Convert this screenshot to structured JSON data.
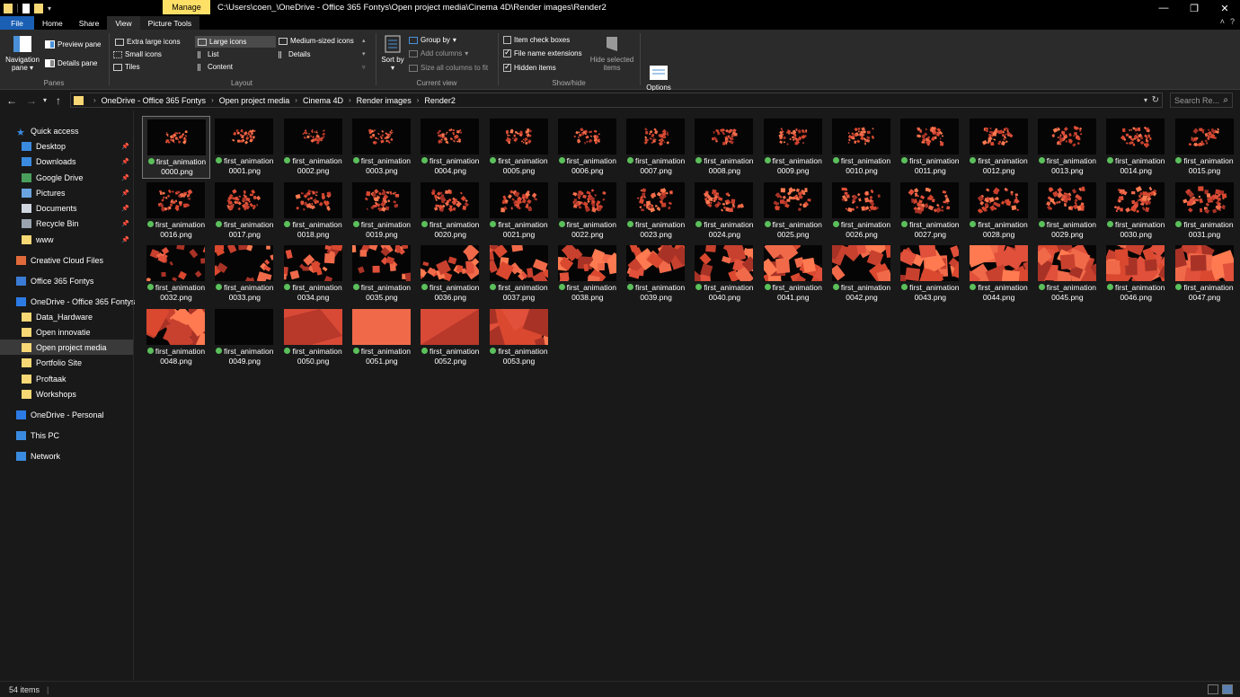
{
  "window": {
    "title_path": "C:\\Users\\coen_\\OneDrive - Office 365 Fontys\\Open project media\\Cinema 4D\\Render images\\Render2",
    "contextual_tab_header": "Manage",
    "controls": {
      "minimize": "—",
      "maximize": "❐",
      "close": "✕"
    }
  },
  "tabs": {
    "file": "File",
    "home": "Home",
    "share": "Share",
    "view": "View",
    "picture_tools": "Picture Tools",
    "collapse_glyph": "˄",
    "help_glyph": "?"
  },
  "ribbon": {
    "panes": {
      "label": "Panes",
      "navigation_pane": "Navigation pane",
      "preview_pane": "Preview pane",
      "details_pane": "Details pane"
    },
    "layout": {
      "label": "Layout",
      "extra_large_icons": "Extra large icons",
      "large_icons": "Large icons",
      "medium_icons": "Medium-sized icons",
      "small_icons": "Small icons",
      "list": "List",
      "details": "Details",
      "tiles": "Tiles",
      "content": "Content"
    },
    "current_view": {
      "label": "Current view",
      "sort_by": "Sort by",
      "group_by": "Group by",
      "add_columns": "Add columns",
      "size_all_columns": "Size all columns to fit"
    },
    "show_hide": {
      "label": "Show/hide",
      "item_check_boxes": "Item check boxes",
      "item_check_boxes_checked": false,
      "file_name_extensions": "File name extensions",
      "file_name_extensions_checked": true,
      "hidden_items": "Hidden items",
      "hidden_items_checked": true,
      "hide_selected_items": "Hide selected items"
    },
    "options": "Options"
  },
  "address": {
    "breadcrumbs": [
      "OneDrive - Office 365 Fontys",
      "Open project media",
      "Cinema 4D",
      "Render images",
      "Render2"
    ],
    "search_placeholder": "Search Re..."
  },
  "sidebar": {
    "items": [
      {
        "label": "Quick access",
        "icon": "star-icon",
        "pinned": false
      },
      {
        "label": "Desktop",
        "icon": "desktop-icon",
        "pinned": true
      },
      {
        "label": "Downloads",
        "icon": "download-icon",
        "pinned": true
      },
      {
        "label": "Google Drive",
        "icon": "drive-icon",
        "pinned": true
      },
      {
        "label": "Pictures",
        "icon": "pictures-icon",
        "pinned": true
      },
      {
        "label": "Documents",
        "icon": "documents-icon",
        "pinned": true
      },
      {
        "label": "Recycle Bin",
        "icon": "recycle-bin-icon",
        "pinned": true
      },
      {
        "label": "www",
        "icon": "folder-icon",
        "pinned": true
      },
      {
        "label": "Creative Cloud Files",
        "icon": "creative-cloud-icon",
        "pinned": false
      },
      {
        "label": "Office 365 Fontys",
        "icon": "office-icon",
        "pinned": false
      },
      {
        "label": "OneDrive - Office 365 Fontys",
        "icon": "onedrive-icon",
        "pinned": false
      },
      {
        "label": "Data_Hardware",
        "icon": "folder-icon",
        "pinned": false
      },
      {
        "label": "Open innovatie",
        "icon": "folder-icon",
        "pinned": false
      },
      {
        "label": "Open project media",
        "icon": "folder-icon",
        "pinned": false,
        "selected": true
      },
      {
        "label": "Portfolio Site",
        "icon": "folder-icon",
        "pinned": false
      },
      {
        "label": "Proftaak",
        "icon": "folder-icon",
        "pinned": false
      },
      {
        "label": "Workshops",
        "icon": "folder-icon",
        "pinned": false
      },
      {
        "label": "OneDrive - Personal",
        "icon": "onedrive-icon",
        "pinned": false
      },
      {
        "label": "This PC",
        "icon": "pc-icon",
        "pinned": false
      },
      {
        "label": "Network",
        "icon": "network-icon",
        "pinned": false
      }
    ]
  },
  "files": {
    "name_prefix": "first_animation",
    "extension": ".png",
    "numbers": [
      "0000",
      "0001",
      "0002",
      "0003",
      "0004",
      "0005",
      "0006",
      "0007",
      "0008",
      "0009",
      "0010",
      "0011",
      "0012",
      "0013",
      "0014",
      "0015",
      "0016",
      "0017",
      "0018",
      "0019",
      "0020",
      "0021",
      "0022",
      "0023",
      "0024",
      "0025",
      "0026",
      "0027",
      "0028",
      "0029",
      "0030",
      "0031",
      "0032",
      "0033",
      "0034",
      "0035",
      "0036",
      "0037",
      "0038",
      "0039",
      "0040",
      "0041",
      "0042",
      "0043",
      "0044",
      "0045",
      "0046",
      "0047",
      "0048",
      "0049",
      "0050",
      "0051",
      "0052",
      "0053"
    ],
    "selected_index": 0
  },
  "status": {
    "item_count": "54 items"
  },
  "colors": {
    "accent": "#1a5fb4",
    "manage_tab": "#ffe067",
    "folder": "#f8d775",
    "sync_ok": "#5bbf5b",
    "render_red": "#e0503a"
  }
}
